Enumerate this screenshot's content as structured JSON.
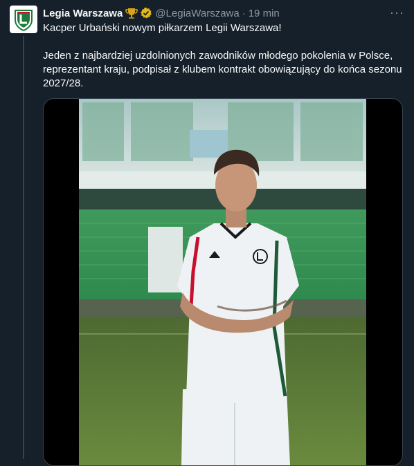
{
  "tweet": {
    "author_name": "Legia Warszawa",
    "handle": "@LegiaWarszawa",
    "separator": "·",
    "time": "19 min",
    "more_label": "···",
    "text_line1": "Kacper Urbański nowym piłkarzem Legii Warszawa!",
    "text_line2": "Jeden z najbardziej uzdolnionych zawodników młodego pokolenia w Polsce, reprezentant kraju, podpisał z klubem kontrakt obowiązujący do końca sezonu 2027/28."
  },
  "icons": {
    "avatar": "legia-crest-icon",
    "badge": "trophy-icon",
    "verified": "verified-badge-icon",
    "more": "more-icon"
  },
  "colors": {
    "background": "#15202b",
    "secondary_text": "#8b98a5",
    "verified": "#e2b719",
    "club_green": "#1e7b3c"
  }
}
